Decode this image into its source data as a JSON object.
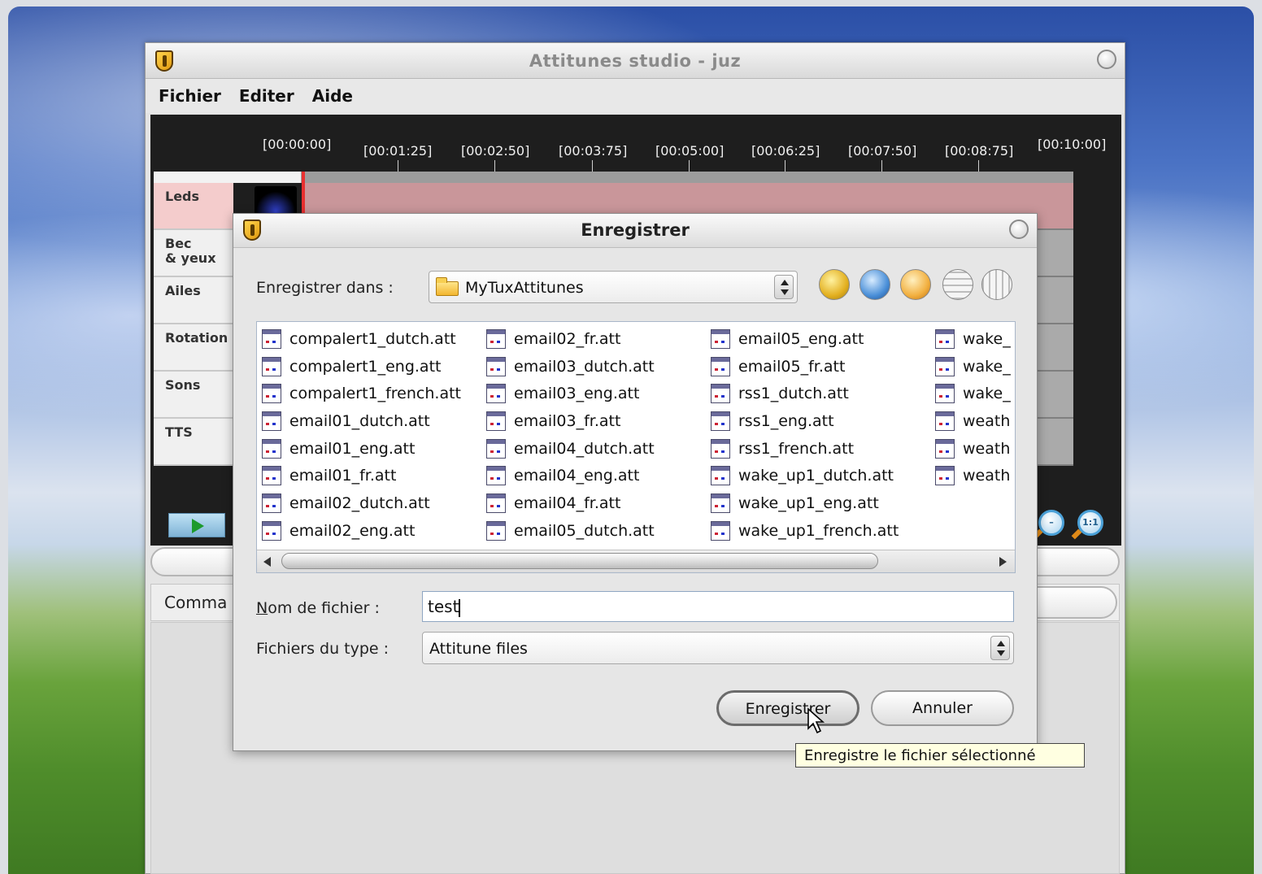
{
  "app": {
    "title": "Attitunes studio - juz",
    "menu": [
      "Fichier",
      "Editer",
      "Aide"
    ]
  },
  "timeline": {
    "ticks": [
      "[00:00:00]",
      "[00:01:25]",
      "[00:02:50]",
      "[00:03:75]",
      "[00:05:00]",
      "[00:06:25]",
      "[00:07:50]",
      "[00:08:75]",
      "[00:10:00]"
    ],
    "tracks": [
      {
        "l1": "Leds",
        "l2": ""
      },
      {
        "l1": "Bec",
        "l2": "& yeux"
      },
      {
        "l1": "Ailes",
        "l2": ""
      },
      {
        "l1": "Rotation",
        "l2": ""
      },
      {
        "l1": "Sons",
        "l2": ""
      },
      {
        "l1": "TTS",
        "l2": ""
      }
    ],
    "zoom_reset_label": "1:1"
  },
  "command_label": "Comma",
  "dialog": {
    "title": "Enregistrer",
    "save_in_label": "Enregistrer dans :",
    "save_in_value": "MyTuxAttitunes",
    "files_col1": [
      "compalert1_dutch.att",
      "compalert1_eng.att",
      "compalert1_french.att",
      "email01_dutch.att",
      "email01_eng.att",
      "email01_fr.att",
      "email02_dutch.att",
      "email02_eng.att"
    ],
    "files_col2": [
      "email02_fr.att",
      "email03_dutch.att",
      "email03_eng.att",
      "email03_fr.att",
      "email04_dutch.att",
      "email04_eng.att",
      "email04_fr.att",
      "email05_dutch.att"
    ],
    "files_col3": [
      "email05_eng.att",
      "email05_fr.att",
      "rss1_dutch.att",
      "rss1_eng.att",
      "rss1_french.att",
      "wake_up1_dutch.att",
      "wake_up1_eng.att",
      "wake_up1_french.att"
    ],
    "files_col4": [
      "wake_",
      "wake_",
      "wake_",
      "weath",
      "weath",
      "weath"
    ],
    "filename_label": "Nom de fichier :",
    "filename_value": "test",
    "filetype_label": "Fichiers du type :",
    "filetype_value": "Attitune files",
    "save_button": "Enregistrer",
    "cancel_button": "Annuler",
    "tooltip": "Enregistre le fichier sélectionné"
  },
  "colors": {
    "active_track": "#f4cccc",
    "playhead": "#e83030",
    "tooltip_bg": "#ffffe1"
  }
}
